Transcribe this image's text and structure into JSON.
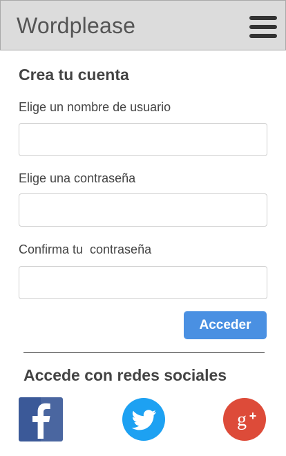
{
  "header": {
    "brand": "Wordplease",
    "menu_icon": "hamburger-menu-icon"
  },
  "signup_form": {
    "title": "Crea tu cuenta",
    "username_label": "Elige un nombre de usuario",
    "username_value": "",
    "password_label": "Elige una contraseña",
    "password_value": "",
    "confirm_label": "Confirma tu  contraseña",
    "confirm_value": "",
    "submit_label": "Acceder"
  },
  "social": {
    "title": "Accede con redes sociales",
    "networks": [
      {
        "name": "facebook",
        "icon": "facebook-icon",
        "color": "#3b5998"
      },
      {
        "name": "twitter",
        "icon": "twitter-icon",
        "color": "#1da1f2"
      },
      {
        "name": "google-plus",
        "icon": "google-plus-icon",
        "color": "#dd4b39"
      }
    ]
  },
  "colors": {
    "header_bg": "#dcdcdc",
    "accent": "#4a90e2"
  }
}
